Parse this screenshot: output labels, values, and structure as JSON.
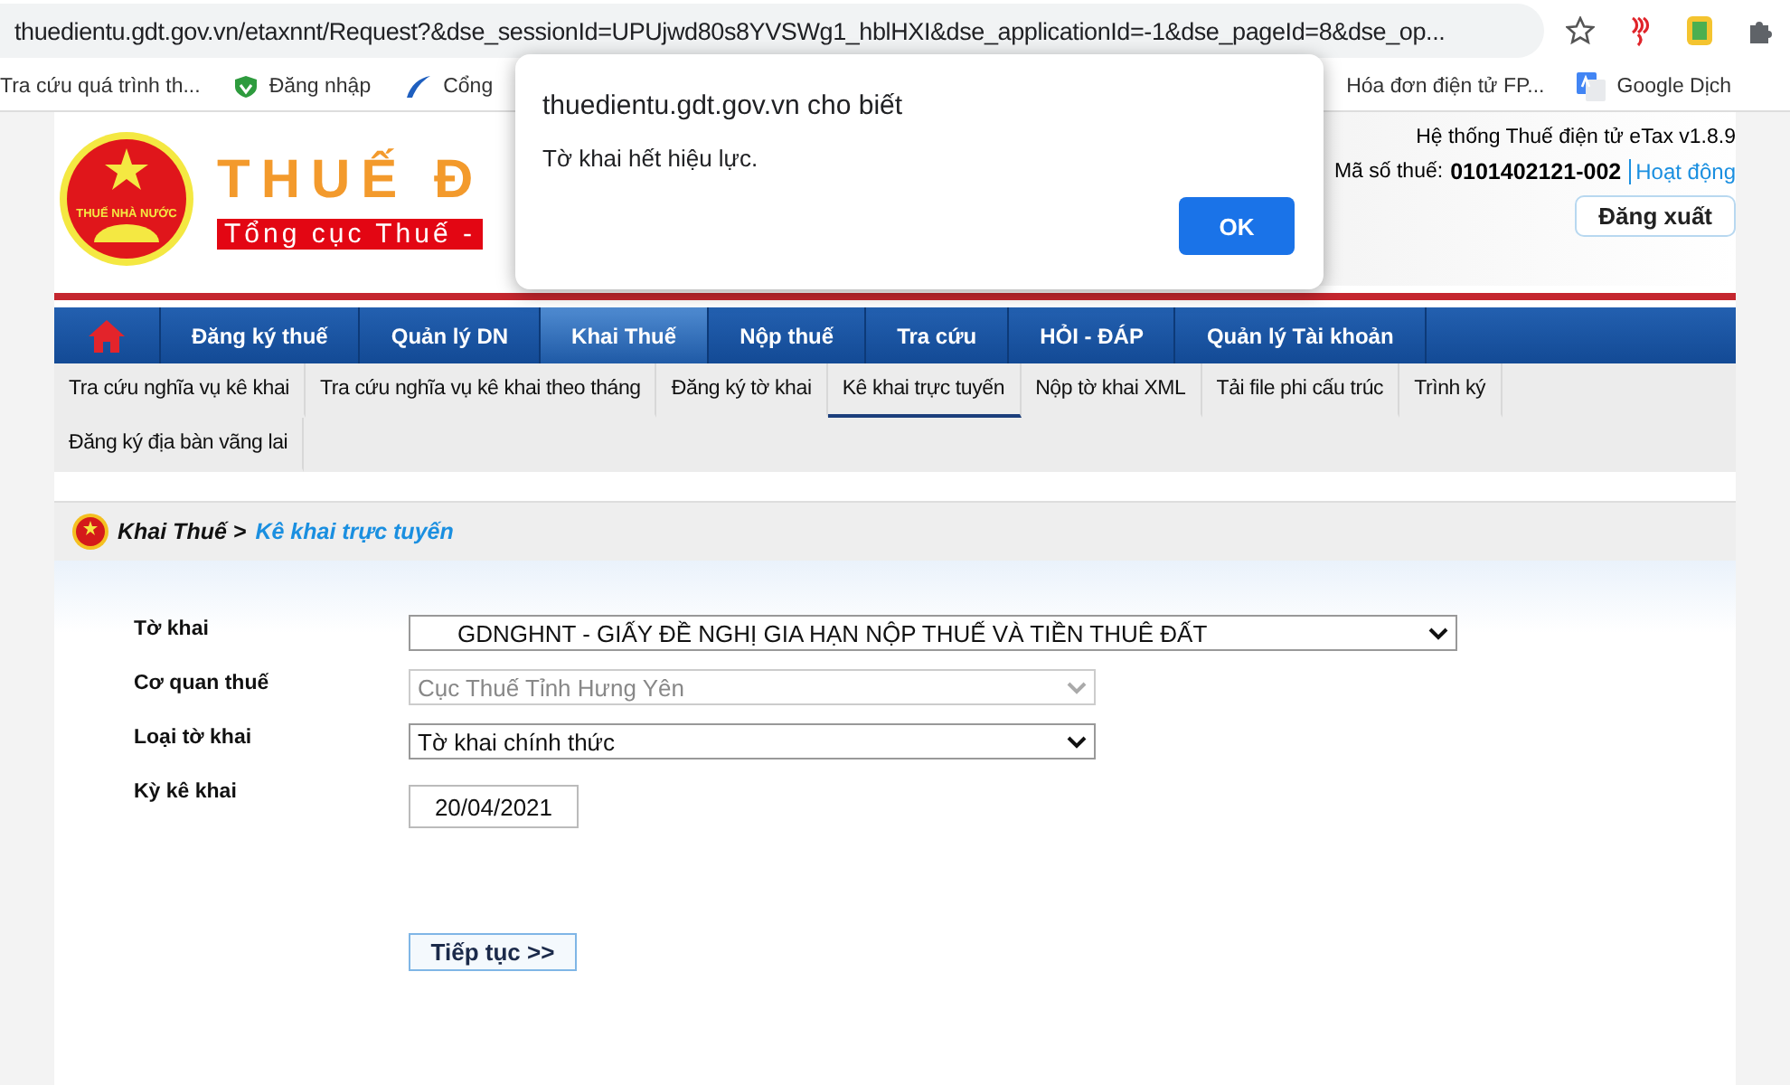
{
  "browser": {
    "url": "thuedientu.gdt.gov.vn/etaxnnt/Request?&dse_sessionId=UPUjwd80s8YVSWg1_hblHXI&dse_applicationId=-1&dse_pageId=8&dse_op...",
    "bookmarks": [
      {
        "label": "Tra cứu quá trình th..."
      },
      {
        "label": "Đăng nhập"
      },
      {
        "label": "Cổng"
      },
      {
        "label": "Hóa đơn điện tử FP..."
      },
      {
        "label": "Google Dịch"
      }
    ]
  },
  "header": {
    "logo_text": "THUẾ NHÀ NƯỚC",
    "title": "THUẾ Đ",
    "subtitle": "Tổng cục Thuế -",
    "system": "Hệ thống Thuế điện tử eTax v1.8.9",
    "tax_label": "Mã số thuế:",
    "tax_code": "0101402121-002",
    "activity_link": "Hoạt động",
    "logout": "Đăng xuất"
  },
  "nav": [
    {
      "label": "Đăng ký thuế",
      "selected": false
    },
    {
      "label": "Quản lý DN",
      "selected": false
    },
    {
      "label": "Khai Thuế",
      "selected": true
    },
    {
      "label": "Nộp thuế",
      "selected": false
    },
    {
      "label": "Tra cứu",
      "selected": false
    },
    {
      "label": "HỎI - ĐÁP",
      "selected": false
    },
    {
      "label": "Quản lý Tài khoản",
      "selected": false
    }
  ],
  "subnav": [
    {
      "label": "Tra cứu nghĩa vụ kê khai",
      "selected": false
    },
    {
      "label": "Tra cứu nghĩa vụ kê khai theo tháng",
      "selected": false
    },
    {
      "label": "Đăng ký tờ khai",
      "selected": false
    },
    {
      "label": "Kê khai trực tuyến",
      "selected": true
    },
    {
      "label": "Nộp tờ khai XML",
      "selected": false
    },
    {
      "label": "Tải file phi cấu trúc",
      "selected": false
    },
    {
      "label": "Trình ký",
      "selected": false
    },
    {
      "label": "Đăng ký địa bàn vãng lai",
      "selected": false
    }
  ],
  "breadcrumb": {
    "parent": "Khai Thuế >",
    "current": "Kê khai trực tuyến"
  },
  "form": [
    {
      "label": "Tờ khai",
      "kind": "select",
      "value": "GDNGHNT - GIẤY ĐỀ NGHỊ GIA HẠN NỘP THUẾ VÀ TIỀN THUÊ ĐẤT",
      "disabled": false
    },
    {
      "label": "Cơ quan thuế",
      "kind": "select",
      "value": "Cục Thuế Tỉnh Hưng Yên",
      "disabled": true
    },
    {
      "label": "Loại tờ khai",
      "kind": "select",
      "value": "Tờ khai chính thức",
      "disabled": false
    },
    {
      "label": "Kỳ kê khai",
      "kind": "date",
      "value": "20/04/2021",
      "disabled": false
    }
  ],
  "continue_button": "Tiếp tục >>",
  "dialog": {
    "title": "thuedientu.gdt.gov.vn cho biết",
    "message": "Tờ khai hết hiệu lực.",
    "ok": "OK"
  }
}
